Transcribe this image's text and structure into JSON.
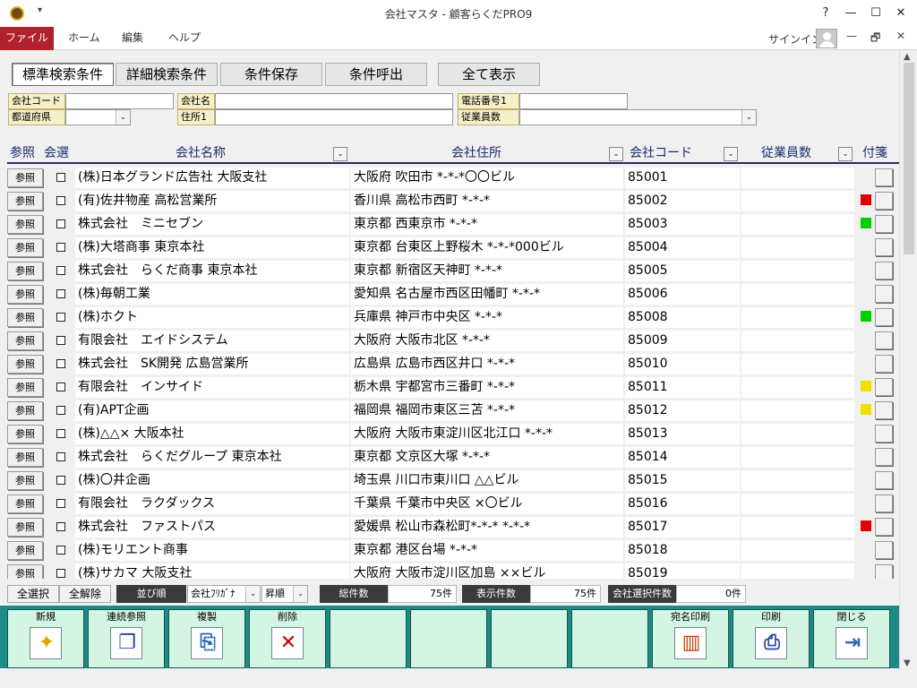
{
  "window": {
    "title": "会社マスタ - 顧客らくだPRO9",
    "qa_arrow": "▾",
    "help": "?",
    "minimize": "—",
    "maximize": "☐",
    "close": "✕"
  },
  "ribbon": {
    "file": "ファイル",
    "tabs": [
      "ホーム",
      "編集",
      "ヘルプ"
    ],
    "signin": "サインイン",
    "restore_min": "—",
    "restore_max": "🗗",
    "restore_close": "✕"
  },
  "search_tabs": [
    "標準検索条件",
    "詳細検索条件",
    "条件保存",
    "条件呼出",
    "全て表示"
  ],
  "filters": {
    "company_code_label": "会社コード",
    "company_name_label": "会社名",
    "phone_label": "電話番号1",
    "prefecture_label": "都道府県",
    "address_label": "住所1",
    "employees_label": "従業員数",
    "dropdown_arrow": "⌄"
  },
  "grid": {
    "headers": {
      "ref": "参照",
      "select": "会選",
      "name": "会社名称",
      "address": "会社住所",
      "code": "会社コード",
      "employees": "従業員数",
      "tag": "付箋"
    },
    "ref_label": "参照",
    "rows": [
      {
        "name": "(株)日本グランド広告社 大阪支社",
        "address": "大阪府 吹田市 *-*-*〇〇ビル",
        "code": "85001",
        "employees": "",
        "tag": ""
      },
      {
        "name": "(有)佐井物産 高松営業所",
        "address": "香川県 高松市西町 *-*-*",
        "code": "85002",
        "employees": "",
        "tag": "#e00000"
      },
      {
        "name": "株式会社　ミニセブン",
        "address": "東京都 西東京市 *-*-*",
        "code": "85003",
        "employees": "",
        "tag": "#00d000"
      },
      {
        "name": "(株)大塔商事 東京本社",
        "address": "東京都 台東区上野桜木 *-*-*000ビル",
        "code": "85004",
        "employees": "",
        "tag": ""
      },
      {
        "name": "株式会社　らくだ商事 東京本社",
        "address": "東京都 新宿区天神町 *-*-*",
        "code": "85005",
        "employees": "",
        "tag": ""
      },
      {
        "name": "(株)毎朝工業",
        "address": "愛知県 名古屋市西区田幡町 *-*-*",
        "code": "85006",
        "employees": "",
        "tag": ""
      },
      {
        "name": "(株)ホクト",
        "address": "兵庫県 神戸市中央区 *-*-*",
        "code": "85008",
        "employees": "",
        "tag": "#00d000"
      },
      {
        "name": "有限会社　エイドシステム",
        "address": "大阪府 大阪市北区 *-*-*",
        "code": "85009",
        "employees": "",
        "tag": ""
      },
      {
        "name": "株式会社　SK開発 広島営業所",
        "address": "広島県 広島市西区井口 *-*-*",
        "code": "85010",
        "employees": "",
        "tag": ""
      },
      {
        "name": "有限会社　インサイド",
        "address": "栃木県 宇都宮市三番町 *-*-*",
        "code": "85011",
        "employees": "",
        "tag": "#f0e000"
      },
      {
        "name": "(有)APT企画",
        "address": "福岡県 福岡市東区三苫 *-*-*",
        "code": "85012",
        "employees": "",
        "tag": "#f0e000"
      },
      {
        "name": "(株)△△× 大阪本社",
        "address": "大阪府 大阪市東淀川区北江口 *-*-*",
        "code": "85013",
        "employees": "",
        "tag": ""
      },
      {
        "name": "株式会社　らくだグループ 東京本社",
        "address": "東京都 文京区大塚 *-*-*",
        "code": "85014",
        "employees": "",
        "tag": ""
      },
      {
        "name": "(株)〇井企画",
        "address": "埼玉県 川口市東川口 △△ビル",
        "code": "85015",
        "employees": "",
        "tag": ""
      },
      {
        "name": "有限会社　ラクダックス",
        "address": "千葉県 千葉市中央区 ×〇ビル",
        "code": "85016",
        "employees": "",
        "tag": ""
      },
      {
        "name": "株式会社　ファストパス",
        "address": "愛媛県 松山市森松町*-*-* *-*-*",
        "code": "85017",
        "employees": "",
        "tag": "#e00000"
      },
      {
        "name": "(株)モリエント商事",
        "address": "東京都 港区台場 *-*-*",
        "code": "85018",
        "employees": "",
        "tag": ""
      },
      {
        "name": "(株)サカマ 大阪支社",
        "address": "大阪府 大阪市淀川区加島 ××ビル",
        "code": "85019",
        "employees": "",
        "tag": ""
      }
    ]
  },
  "status": {
    "select_all": "全選択",
    "deselect_all": "全解除",
    "sort_label": "並び順",
    "sort_field": "会社ﾌﾘｶﾞﾅ",
    "sort_order": "昇順",
    "total_label": "総件数",
    "total_value": "75件",
    "display_label": "表示件数",
    "display_value": "75件",
    "selected_label": "会社選択件数",
    "selected_value": "0件"
  },
  "toolbar": {
    "new": "新規",
    "continuous_ref": "連続参照",
    "duplicate": "複製",
    "delete": "削除",
    "address_print": "宛名印刷",
    "print": "印刷",
    "close": "閉じる"
  },
  "scroll": {
    "up": "▲",
    "down": "▼"
  },
  "colors": {
    "ribbon_file": "#b0222b",
    "toolbar": "#1e8a84",
    "key_bg": "#d4f5e4",
    "header_text": "#1d2d6b"
  }
}
